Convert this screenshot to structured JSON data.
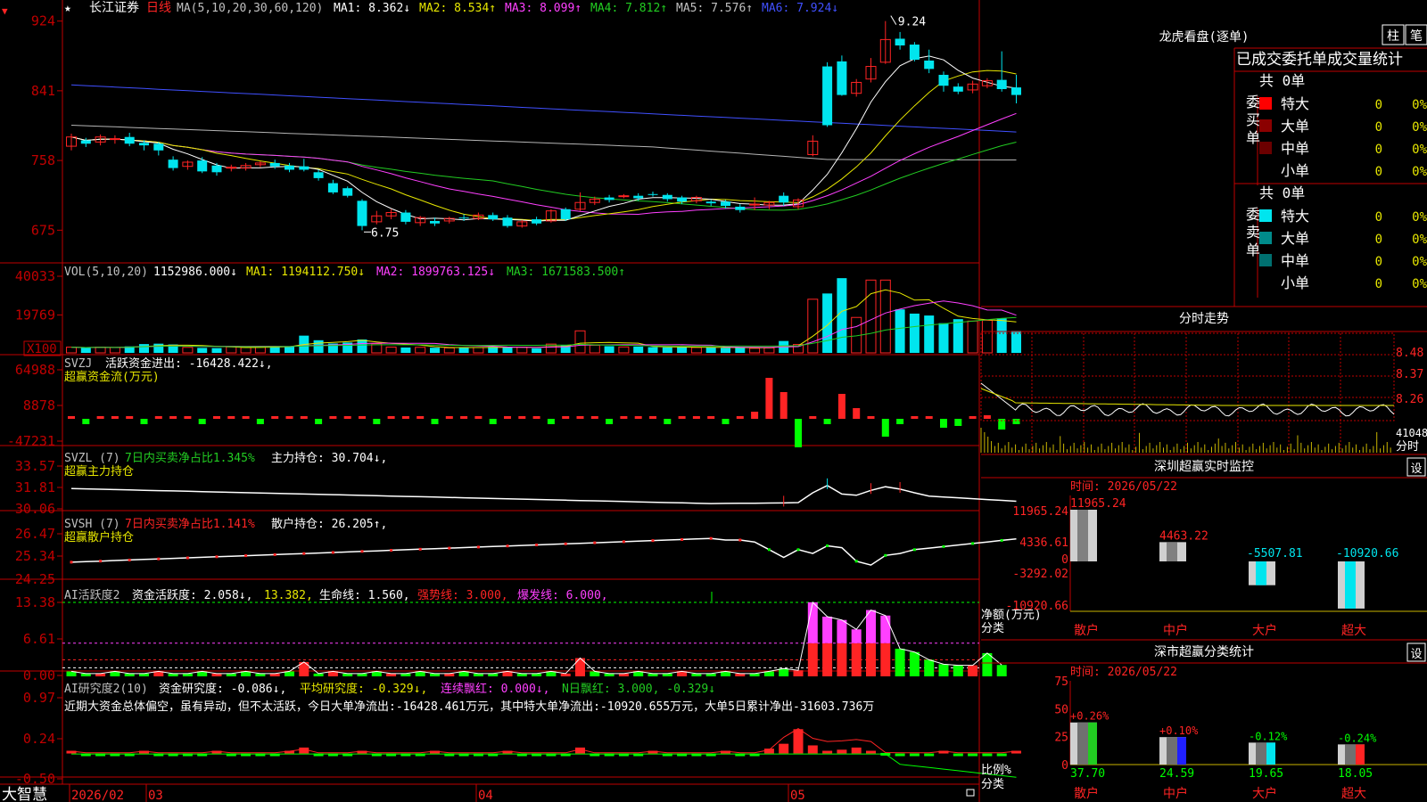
{
  "app": {
    "brand": "大智慧",
    "stock_name": "长江证券",
    "period": "日线",
    "star": "★",
    "topleft_arrow": "▼"
  },
  "colors": {
    "up": "#ff2424",
    "down": "#00e5ee",
    "axis": "#c00000",
    "white": "#ffffff",
    "yellow": "#e6e600",
    "magenta": "#ff40ff",
    "green": "#22cc22",
    "grey": "#b4b4b4",
    "blue": "#4050ff",
    "bright_green": "#00ff00",
    "olive": "#c8b400"
  },
  "main": {
    "legend": [
      {
        "text": "MA(5,10,20,30,60,120)",
        "color": "#c0c0c0"
      },
      {
        "text": "MA1: 8.362↓",
        "color": "#ffffff"
      },
      {
        "text": "MA2: 8.534↑",
        "color": "#e6e600"
      },
      {
        "text": "MA3: 8.099↑",
        "color": "#ff40ff"
      },
      {
        "text": "MA4: 7.812↑",
        "color": "#22cc22"
      },
      {
        "text": "MA5: 7.576↑",
        "color": "#c0c0c0"
      },
      {
        "text": "MA6: 7.924↓",
        "color": "#4050ff"
      }
    ],
    "y_ticks": [
      "924",
      "841",
      "758",
      "675"
    ],
    "high_label": "9.24",
    "low_label": "6.75"
  },
  "vol": {
    "legend": [
      {
        "text": "VOL(5,10,20)",
        "color": "#c0c0c0"
      },
      {
        "text": "1152986.000↓",
        "color": "#ffffff"
      },
      {
        "text": "MA1: 1194112.750↓",
        "color": "#e6e600"
      },
      {
        "text": "MA2: 1899763.125↓",
        "color": "#ff40ff"
      },
      {
        "text": "MA3: 1671583.500↑",
        "color": "#22cc22"
      }
    ],
    "y_ticks": [
      "40033",
      "19769"
    ],
    "unit": "X100"
  },
  "svzj": {
    "legend": [
      {
        "text": "SVZJ",
        "color": "#c0c0c0"
      },
      {
        "text": "活跃资金进出: -16428.422↓,",
        "color": "#ffffff"
      }
    ],
    "title": "超赢资金流(万元)",
    "y_ticks": [
      "64988",
      "8878",
      "-47231"
    ]
  },
  "svzl": {
    "legend": [
      {
        "text": "SVZL (7)",
        "color": "#c0c0c0"
      },
      {
        "text": "7日内买卖净占比1.345%",
        "color": "#22cc22"
      },
      {
        "text": "主力持仓: 30.704↓,",
        "color": "#ffffff"
      }
    ],
    "title": "超赢主力持仓",
    "y_ticks": [
      "33.57",
      "31.81",
      "30.06"
    ]
  },
  "svsh": {
    "legend": [
      {
        "text": "SVSH (7)",
        "color": "#c0c0c0"
      },
      {
        "text": "7日内买卖净占比1.141%",
        "color": "#ff2424"
      },
      {
        "text": "散户持仓: 26.205↑,",
        "color": "#ffffff"
      }
    ],
    "title": "超赢散户持仓",
    "y_ticks": [
      "26.47",
      "25.34",
      "24.25"
    ]
  },
  "ai1": {
    "legend": [
      {
        "text": "AI活跃度2",
        "color": "#c0c0c0"
      },
      {
        "text": "资金活跃度: 2.058↓,",
        "color": "#ffffff"
      },
      {
        "text": "13.382,",
        "color": "#e6e600"
      },
      {
        "text": "生命线: 1.560,",
        "color": "#ffffff"
      },
      {
        "text": "强势线: 3.000,",
        "color": "#ff2424"
      },
      {
        "text": "爆发线: 6.000,",
        "color": "#ff40ff"
      }
    ],
    "y_ticks": [
      "13.38",
      "6.61",
      "0.00"
    ]
  },
  "ai2": {
    "legend": [
      {
        "text": "AI研究度2(10)",
        "color": "#c0c0c0"
      },
      {
        "text": "资金研究度: -0.086↓,",
        "color": "#ffffff"
      },
      {
        "text": "平均研究度: -0.329↓,",
        "color": "#e6e600"
      },
      {
        "text": "连续飘红: 0.000↓,",
        "color": "#ff40ff"
      },
      {
        "text": "N日飘红: 3.000, -0.329↓",
        "color": "#22cc22"
      }
    ],
    "comment": "近期大资金总体偏空，虽有异动，但不太活跃，今日大单净流出:-16428.461万元，其中特大单净流出:-10920.655万元，大单5日累计净出-31603.736万",
    "y_ticks": [
      "0.97",
      "0.24",
      "-0.50"
    ]
  },
  "dates": [
    "2026/02",
    "03",
    "04",
    "05"
  ],
  "right": {
    "lhb_title": "龙虎看盘(逐单)",
    "btn_bar": "柱",
    "btn_line": "笔",
    "order_header": "已成交委托单成交量统计",
    "buy_side": {
      "title": "委买单",
      "count": "共 0单",
      "rows": [
        {
          "label": "特大",
          "count": "0",
          "pct": "0%",
          "color": "#ff0000"
        },
        {
          "label": "大单",
          "count": "0",
          "pct": "0%",
          "color": "#8b0000"
        },
        {
          "label": "中单",
          "count": "0",
          "pct": "0%",
          "color": "#6b0000"
        },
        {
          "label": "小单",
          "count": "0",
          "pct": "0%",
          "color": ""
        }
      ]
    },
    "sell_side": {
      "title": "委卖单",
      "count": "共 0单",
      "rows": [
        {
          "label": "特大",
          "count": "0",
          "pct": "0%",
          "color": "#00e5ee"
        },
        {
          "label": "大单",
          "count": "0",
          "pct": "0%",
          "color": "#008b8b"
        },
        {
          "label": "中单",
          "count": "0",
          "pct": "0%",
          "color": "#007070"
        },
        {
          "label": "小单",
          "count": "0",
          "pct": "0%",
          "color": ""
        }
      ]
    },
    "intraday_title": "分时走势",
    "intraday_ticks": [
      "8.48",
      "8.37",
      "8.26"
    ],
    "intraday_vol": "41048",
    "intraday_vol_label": "分时",
    "monitor": {
      "title": "深圳超赢实时监控",
      "settings": "设",
      "time": "时间: 2026/05/22",
      "y_ticks": [
        "11965.24",
        "4336.61",
        "0",
        "-3292.02",
        "-10920.66"
      ],
      "y_label_1": "净额(万元)",
      "y_label_2": "分类",
      "bars": [
        {
          "name": "散户",
          "value": "11965.24"
        },
        {
          "name": "中户",
          "value": "4463.22"
        },
        {
          "name": "大户",
          "value": "-5507.81"
        },
        {
          "name": "超大",
          "value": "-10920.66"
        }
      ]
    },
    "classify": {
      "title": "深市超赢分类统计",
      "settings": "设",
      "time": "时间: 2026/05/22",
      "y_ticks": [
        "75",
        "50",
        "25",
        "0"
      ],
      "y_label_1": "比例%",
      "y_label_2": "分类",
      "bars": [
        {
          "name": "散户",
          "top": "+0.26%",
          "value": "37.70"
        },
        {
          "name": "中户",
          "top": "+0.10%",
          "value": "24.59"
        },
        {
          "name": "大户",
          "top": "-0.12%",
          "value": "19.65"
        },
        {
          "name": "超大",
          "top": "-0.24%",
          "value": "18.05"
        }
      ]
    }
  },
  "chart_data": {
    "type": "candlestick",
    "price_ylim": [
      6.52,
      9.3
    ],
    "candles": [
      [
        7.75,
        7.86,
        7.9,
        7.7
      ],
      [
        7.82,
        7.78,
        7.85,
        7.74
      ],
      [
        7.8,
        7.86,
        7.89,
        7.76
      ],
      [
        7.83,
        7.84,
        7.88,
        7.78
      ],
      [
        7.86,
        7.78,
        7.91,
        7.75
      ],
      [
        7.79,
        7.76,
        7.82,
        7.7
      ],
      [
        7.78,
        7.7,
        7.8,
        7.64
      ],
      [
        7.59,
        7.49,
        7.63,
        7.46
      ],
      [
        7.51,
        7.56,
        7.58,
        7.47
      ],
      [
        7.58,
        7.45,
        7.62,
        7.43
      ],
      [
        7.52,
        7.44,
        7.55,
        7.4
      ],
      [
        7.49,
        7.5,
        7.53,
        7.45
      ],
      [
        7.49,
        7.52,
        7.55,
        7.46
      ],
      [
        7.53,
        7.55,
        7.57,
        7.5
      ],
      [
        7.55,
        7.51,
        7.59,
        7.48
      ],
      [
        7.52,
        7.47,
        7.55,
        7.44
      ],
      [
        7.51,
        7.47,
        7.6,
        7.45
      ],
      [
        7.44,
        7.37,
        7.47,
        7.34
      ],
      [
        7.31,
        7.2,
        7.35,
        7.18
      ],
      [
        7.25,
        7.16,
        7.27,
        7.14
      ],
      [
        7.1,
        6.8,
        7.12,
        6.75
      ],
      [
        6.85,
        6.92,
        6.98,
        6.82
      ],
      [
        6.92,
        6.96,
        7.0,
        6.88
      ],
      [
        6.96,
        6.85,
        6.99,
        6.82
      ],
      [
        6.84,
        6.9,
        6.92,
        6.8
      ],
      [
        6.86,
        6.83,
        6.9,
        6.8
      ],
      [
        6.86,
        6.89,
        6.91,
        6.83
      ],
      [
        6.9,
        6.89,
        6.94,
        6.86
      ],
      [
        6.89,
        6.93,
        6.96,
        6.87
      ],
      [
        6.93,
        6.88,
        6.96,
        6.86
      ],
      [
        6.9,
        6.8,
        6.93,
        6.78
      ],
      [
        6.8,
        6.85,
        6.87,
        6.78
      ],
      [
        6.88,
        6.83,
        6.91,
        6.81
      ],
      [
        6.86,
        6.98,
        7.0,
        6.84
      ],
      [
        7.0,
        6.88,
        7.02,
        6.86
      ],
      [
        7.0,
        7.08,
        7.2,
        6.98
      ],
      [
        7.08,
        7.12,
        7.15,
        7.05
      ],
      [
        7.14,
        7.11,
        7.17,
        7.08
      ],
      [
        7.15,
        7.16,
        7.18,
        7.13
      ],
      [
        7.16,
        7.13,
        7.19,
        7.1
      ],
      [
        7.18,
        7.17,
        7.21,
        7.15
      ],
      [
        7.17,
        7.12,
        7.19,
        7.09
      ],
      [
        7.14,
        7.09,
        7.16,
        7.06
      ],
      [
        7.1,
        7.14,
        7.16,
        7.07
      ],
      [
        7.09,
        7.07,
        7.11,
        7.04
      ],
      [
        7.09,
        7.04,
        7.11,
        7.01
      ],
      [
        7.03,
        6.99,
        7.06,
        6.96
      ],
      [
        7.06,
        7.06,
        7.14,
        6.99
      ],
      [
        7.05,
        7.08,
        7.1,
        7.0
      ],
      [
        7.16,
        7.08,
        7.2,
        7.04
      ],
      [
        7.03,
        7.11,
        7.13,
        7.0
      ],
      [
        7.65,
        7.81,
        7.88,
        7.63
      ],
      [
        8.7,
        8.0,
        8.75,
        7.98
      ],
      [
        8.76,
        8.36,
        8.83,
        8.35
      ],
      [
        8.38,
        8.51,
        8.55,
        8.34
      ],
      [
        8.55,
        8.7,
        8.8,
        8.51
      ],
      [
        8.75,
        9.02,
        9.24,
        8.73
      ],
      [
        9.03,
        8.95,
        9.11,
        8.9
      ],
      [
        8.96,
        8.78,
        8.99,
        8.76
      ],
      [
        8.77,
        8.67,
        8.9,
        8.62
      ],
      [
        8.6,
        8.47,
        8.64,
        8.4
      ],
      [
        8.46,
        8.4,
        8.5,
        8.37
      ],
      [
        8.42,
        8.49,
        8.53,
        8.38
      ],
      [
        8.47,
        8.53,
        8.56,
        8.44
      ],
      [
        8.54,
        8.43,
        8.88,
        8.4
      ],
      [
        8.45,
        8.36,
        8.6,
        8.26
      ]
    ],
    "volume": [
      3,
      2.6,
      3,
      2.8,
      3.4,
      4.6,
      4.8,
      4.4,
      2.9,
      2.6,
      2.5,
      3.2,
      2.8,
      3.1,
      3.5,
      3.4,
      9,
      6.6,
      4.9,
      5.4,
      7,
      4.8,
      3,
      2.8,
      2.9,
      2.7,
      2.6,
      2.9,
      2.8,
      3.2,
      3.1,
      3,
      2.4,
      4.6,
      3.9,
      11.5,
      4,
      3.5,
      3.1,
      3.3,
      3,
      2.9,
      3,
      2.8,
      2.9,
      2.6,
      2.7,
      2.4,
      2.6,
      6.2,
      4.4,
      28,
      31,
      39,
      18.5,
      38,
      38,
      22.7,
      20.5,
      19.5,
      15.5,
      17.6,
      16.6,
      17,
      18,
      11.5
    ],
    "flow": [
      0,
      0,
      0,
      0,
      0,
      0,
      0,
      0,
      0,
      0,
      0,
      0,
      0,
      0,
      0,
      0,
      0,
      0,
      0,
      0,
      0,
      0,
      0,
      0,
      0,
      0,
      0,
      0,
      0,
      0,
      0,
      0,
      0,
      0,
      0,
      0,
      0,
      0,
      0,
      0,
      0,
      0,
      0,
      0,
      0,
      0,
      0,
      0,
      0,
      0,
      0,
      0,
      0,
      0,
      0,
      0,
      0,
      0,
      0,
      0,
      0,
      0,
      0,
      0,
      0,
      0
    ]
  }
}
